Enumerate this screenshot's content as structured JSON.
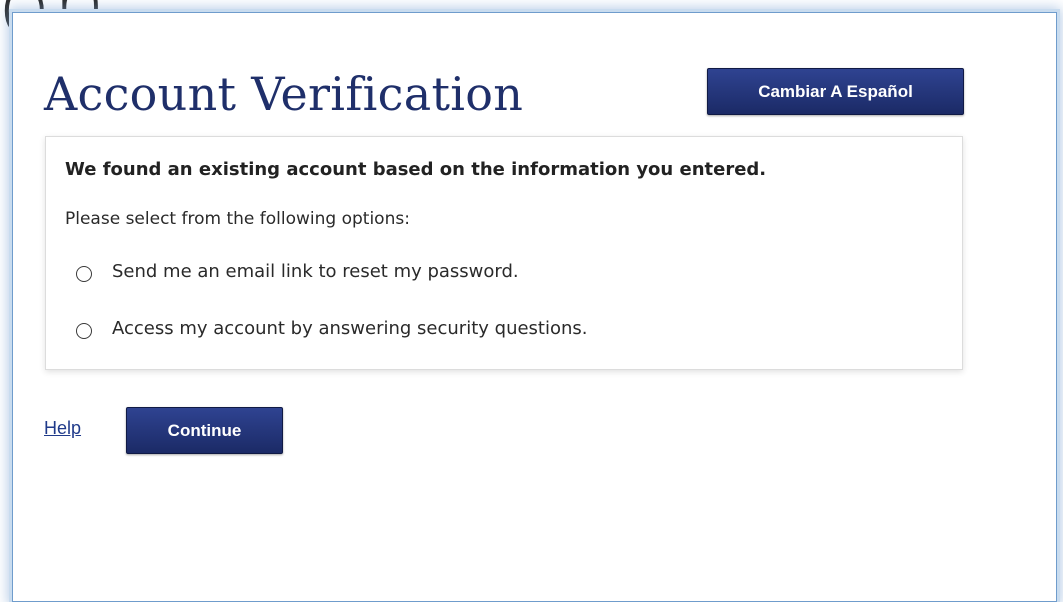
{
  "background_window": {
    "title_fragment": "on"
  },
  "dialog": {
    "title": "Account Verification",
    "language_button_label": "Cambiar A Español",
    "panel": {
      "heading": "We found an existing account based on the information you entered.",
      "instructions": "Please select from the following options:",
      "options": [
        {
          "label": "Send me an email link to reset my password.",
          "selected": false
        },
        {
          "label": "Access my account by answering security questions.",
          "selected": false
        }
      ]
    },
    "footer": {
      "help_label": "Help",
      "continue_label": "Continue"
    }
  },
  "colors": {
    "primary_button": "#1f2f6e",
    "title_text": "#1f2f6a",
    "link": "#1f3a8a",
    "dialog_border": "#6f9ccc"
  }
}
